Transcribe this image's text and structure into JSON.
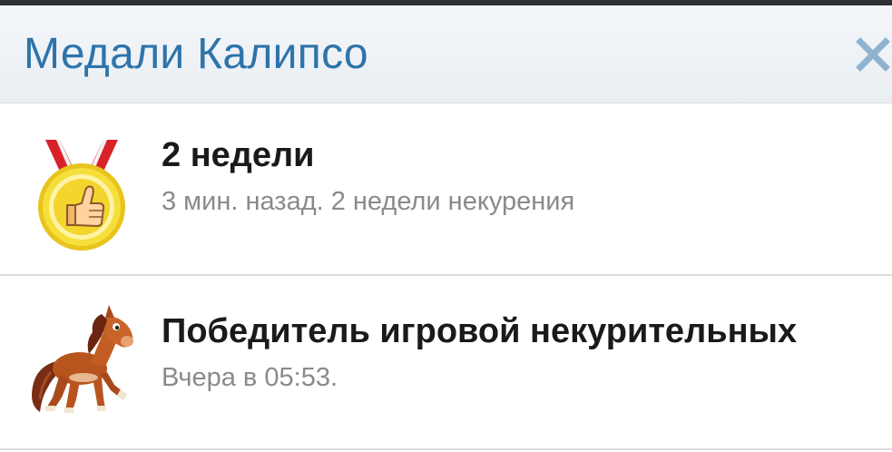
{
  "dialog": {
    "title": "Медали Калипсо",
    "close_icon": "close-icon"
  },
  "medals": [
    {
      "name": "2 недели",
      "meta": "3 мин. назад. 2 недели некурения",
      "icon": "gold-medal-thumbs-up-icon"
    },
    {
      "name": "Победитель игровой некурительных",
      "meta": "Вчера в 05:53.",
      "icon": "horse-icon"
    }
  ],
  "colors": {
    "title": "#2e74aa",
    "close": "#8fb3cf",
    "name": "#1a1a1a",
    "meta": "#8a8a8a",
    "divider": "#dcdcdc"
  }
}
